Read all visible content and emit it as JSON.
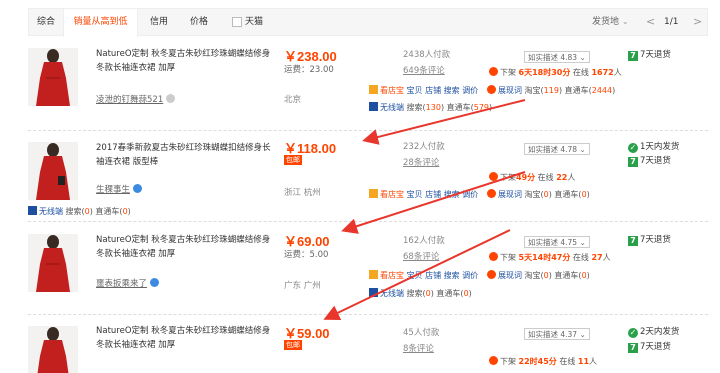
{
  "sort_bar": {
    "tabs": [
      "综合",
      "销量从高到低",
      "信用",
      "价格"
    ],
    "tmall_label": "天猫",
    "ship_from_label": "发货地",
    "page_indicator": "1/1",
    "prev": "<",
    "next": ">"
  },
  "items": [
    {
      "title": "NatureO定制 秋冬夏古朱砂红珍珠蝴蝶结修身冬款长袖连衣裙 加厚",
      "shop": "凌泄的钉舞蒜521",
      "price": "￥238.00",
      "freight": "运费：23.00",
      "location": "北京",
      "paid": "2438人付款",
      "reviews": "649条评论",
      "desc": "如实描述 4.83",
      "listing": [
        "下架 ",
        "6天18时30分",
        " 在线 ",
        "1672",
        "人"
      ],
      "tools1": [
        "看店宝",
        "宝贝",
        "店铺",
        "搜索",
        "调价"
      ],
      "tools1_b": [
        "展现词",
        "淘宝(",
        "119",
        ") 直通车(",
        "2444",
        ")"
      ],
      "tools2": [
        "无线端",
        "搜索(",
        "130",
        ") 直通车(",
        "579",
        ")"
      ],
      "service": [
        "7天退货"
      ]
    },
    {
      "title": "2017春季新款夏古朱砂红珍珠蝴蝶扣结修身长袖连衣裙 版型棒",
      "shop": "生稞事生",
      "price": "￥118.00",
      "baoyou": "包邮",
      "location": "浙江 杭州",
      "paid": "232人付款",
      "reviews": "28条评论",
      "desc": "如实描述 4.78",
      "listing": [
        "下架",
        "49分",
        " 在线 ",
        "22",
        "人"
      ],
      "tools1": [
        "看店宝",
        "宝贝",
        "店铺",
        "搜索",
        "调价"
      ],
      "tools1_b": [
        "展现词",
        "淘宝(",
        "0",
        ") 直通车(",
        "0",
        ")"
      ],
      "tools2": [
        "无线端",
        "搜索(",
        "0",
        ") 直通车(",
        "0",
        ")"
      ],
      "service": [
        "1天内发货",
        "7天退货"
      ]
    },
    {
      "title": "NatureO定制 秋冬夏古朱砂红珍珠蝴蝶结修身冬款长袖连衣裙 加厚",
      "shop": "噩表扳乘来了",
      "price": "￥69.00",
      "freight": "运费：5.00",
      "location": "广东 广州",
      "paid": "162人付款",
      "reviews": "68条评论",
      "desc": "如实描述 4.75",
      "listing": [
        "下架 ",
        "5天14时47分",
        " 在线 ",
        "27",
        "人"
      ],
      "tools1": [
        "看店宝",
        "宝贝",
        "店铺",
        "搜索",
        "调价"
      ],
      "tools1_b": [
        "展现词",
        "淘宝(",
        "0",
        ") 直通车(",
        "0",
        ")"
      ],
      "tools2": [
        "无线端",
        "搜索(",
        "0",
        ") 直通车(",
        "0",
        ")"
      ],
      "service": [
        "7天退货"
      ]
    },
    {
      "title": "NatureO定制 秋冬夏古朱砂红珍珠蝴蝶结修身冬款长袖连衣裙 加厚",
      "shop": "",
      "price": "￥59.00",
      "baoyou": "包邮",
      "location": "",
      "paid": "45人付款",
      "reviews": "8条评论",
      "desc": "如实描述 4.37",
      "listing": [
        "下架 ",
        "22时45分",
        " 在线 ",
        "11",
        "人"
      ],
      "service": [
        "2天内发货",
        "7天退货"
      ]
    }
  ],
  "colors": {
    "accent": "#ff4400",
    "link_blue": "#1e50a2",
    "tmall_green": "#2aa04a",
    "annotation_red": "#e8362c"
  }
}
